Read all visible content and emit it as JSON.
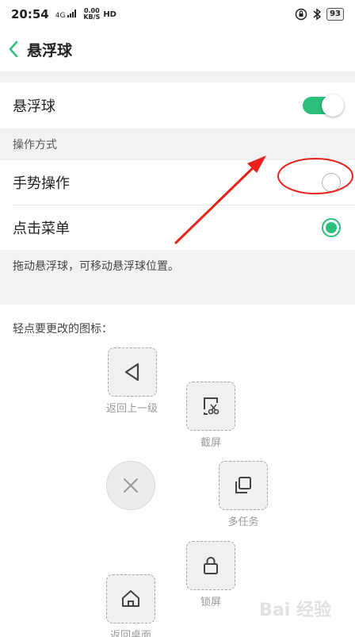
{
  "status_bar": {
    "time": "20:54",
    "network": "4G",
    "speed_value": "0.00",
    "speed_unit": "KB/S",
    "hd": "HD",
    "battery": "93"
  },
  "header": {
    "title": "悬浮球"
  },
  "toggle_row": {
    "label": "悬浮球",
    "enabled": true
  },
  "operation": {
    "section_title": "操作方式",
    "options": [
      {
        "label": "手势操作",
        "selected": false
      },
      {
        "label": "点击菜单",
        "selected": true
      }
    ]
  },
  "hint": "拖动悬浮球，可移动悬浮球位置。",
  "icons_section": {
    "title": "轻点要更改的图标：",
    "items": [
      {
        "label": "返回上一级",
        "icon": "back-triangle-icon"
      },
      {
        "label": "截屏",
        "icon": "screenshot-icon"
      },
      {
        "label": "多任务",
        "icon": "multitask-icon"
      },
      {
        "label": "锁屏",
        "icon": "lock-icon"
      },
      {
        "label": "返回桌面",
        "icon": "home-icon"
      }
    ],
    "center_icon": "close-icon"
  },
  "colors": {
    "accent": "#2bbf7a",
    "annotation": "#e8221b"
  },
  "watermark": "Bai 经验"
}
